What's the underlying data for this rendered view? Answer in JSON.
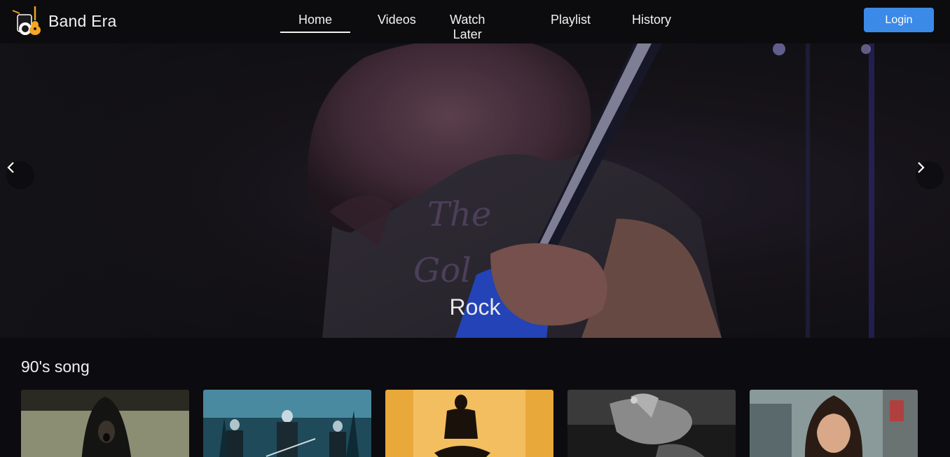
{
  "header": {
    "brand": "Band Era",
    "logo_icon": "music-guitar-logo-icon",
    "nav": [
      {
        "label": "Home",
        "active": true
      },
      {
        "label": "Videos",
        "active": false
      },
      {
        "label": "Watch Later",
        "active": false
      },
      {
        "label": "Playlist",
        "active": false
      },
      {
        "label": "History",
        "active": false
      }
    ],
    "login_label": "Login",
    "accent_color": "#3b8ae8"
  },
  "hero": {
    "caption": "Rock",
    "prev_icon": "chevron-left-icon",
    "next_icon": "chevron-right-icon"
  },
  "section": {
    "title": "90's song",
    "videos": [
      {
        "thumbnail": "hooded-singer-thumbnail"
      },
      {
        "thumbnail": "band-in-forest-thumbnail"
      },
      {
        "thumbnail": "sitting-man-orange-thumbnail"
      },
      {
        "thumbnail": "hands-black-white-thumbnail"
      },
      {
        "thumbnail": "long-hair-man-thumbnail"
      }
    ]
  }
}
